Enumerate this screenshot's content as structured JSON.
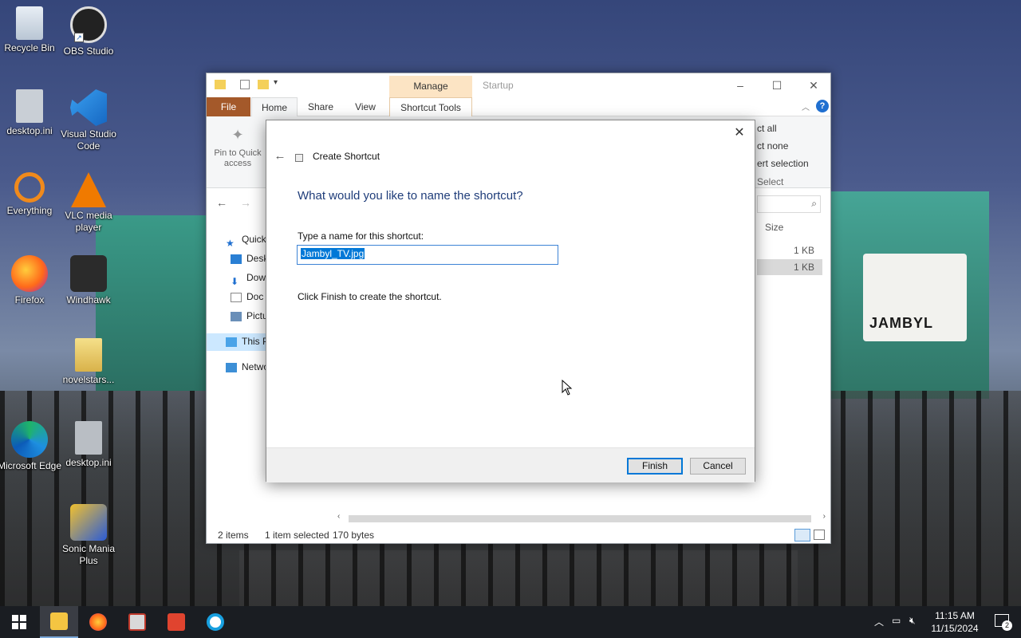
{
  "desktop": {
    "icons": [
      {
        "label": "Recycle Bin"
      },
      {
        "label": "OBS Studio"
      },
      {
        "label": "desktop.ini"
      },
      {
        "label": "Visual Studio Code"
      },
      {
        "label": "Everything"
      },
      {
        "label": "VLC media player"
      },
      {
        "label": "Firefox"
      },
      {
        "label": "Windhawk"
      },
      {
        "label": "novelstars..."
      },
      {
        "label": "Microsoft Edge"
      },
      {
        "label": "desktop.ini"
      },
      {
        "label": "Sonic Mania Plus"
      }
    ],
    "wallpaper_sign": "JAMBYL"
  },
  "explorer": {
    "contextual_tab": "Manage",
    "window_title": "Startup",
    "ribbon_tabs": [
      "File",
      "Home",
      "Share",
      "View",
      "Shortcut Tools"
    ],
    "pin_label": "Pin to Quick access",
    "select_commands": [
      "ct all",
      "ct none",
      "ert selection",
      "Select"
    ],
    "column_size": "Size",
    "sidebar": [
      "Quick",
      "Desk",
      "Dow",
      "Doc",
      "Pictu",
      "This P",
      "Netwo"
    ],
    "file_sizes": [
      "1 KB",
      "1 KB"
    ],
    "status": {
      "items": "2 items",
      "selected": "1 item selected",
      "size": "170 bytes"
    },
    "help": "?"
  },
  "dialog": {
    "title": "Create Shortcut",
    "heading": "What would you like to name the shortcut?",
    "field_label": "Type a name for this shortcut:",
    "field_value": "Jambyl_TV.jpg",
    "hint": "Click Finish to create the shortcut.",
    "finish": "Finish",
    "cancel": "Cancel"
  },
  "taskbar": {
    "time": "11:15 AM",
    "date": "11/15/2024",
    "notification_count": "2"
  },
  "colors": {
    "accent": "#0078d7",
    "file_tab": "#a4592a",
    "manage_tab": "#fce4c4"
  }
}
